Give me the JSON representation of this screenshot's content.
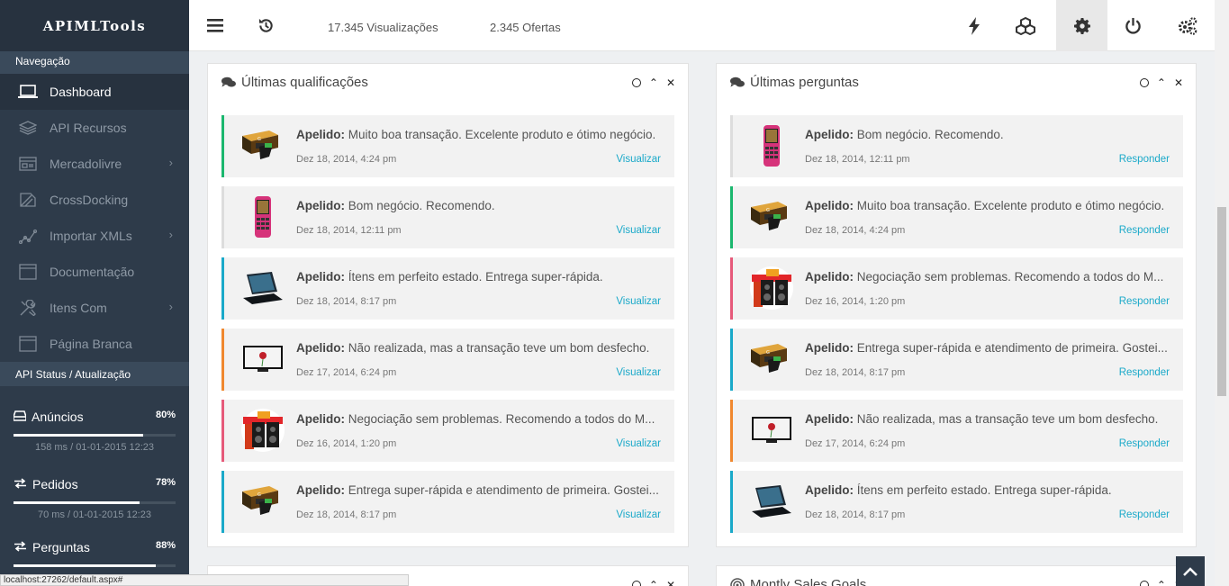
{
  "brand": "APIMLTools",
  "nav_section": "Navegação",
  "nav": [
    {
      "label": "Dashboard",
      "icon": "laptop-icon",
      "active": true
    },
    {
      "label": "API Recursos",
      "icon": "layers-icon"
    },
    {
      "label": "Mercadolivre",
      "icon": "card-icon",
      "chevron": true
    },
    {
      "label": "CrossDocking",
      "icon": "crossdocking-icon"
    },
    {
      "label": "Importar XMLs",
      "icon": "chart-icon",
      "chevron": true
    },
    {
      "label": "Documentação",
      "icon": "document-icon"
    },
    {
      "label": "Itens Com",
      "icon": "tools-icon",
      "chevron": true
    },
    {
      "label": "Página Branca",
      "icon": "blank-page-icon"
    }
  ],
  "api_section": "API Status / Atualização",
  "api": [
    {
      "label": "Anúncios",
      "pct": "80%",
      "meta": "158 ms / 01-01-2015 12:23",
      "progress": 0.8
    },
    {
      "label": "Pedidos",
      "pct": "78%",
      "meta": "70 ms / 01-01-2015 12:23",
      "progress": 0.78
    },
    {
      "label": "Perguntas",
      "pct": "88%",
      "meta": "",
      "progress": 0.88
    }
  ],
  "topbar": {
    "views": "17.345 Visualizações",
    "offers": "2.345 Ofertas"
  },
  "panels": {
    "left": {
      "title": "Últimas qualificações",
      "items": [
        {
          "prefix": "Apelido:",
          "text": " Muito boa transação. Excelente produto e ótimo negócio.",
          "date": "Dez 18, 2014, 4:24 pm",
          "action": "Visualizar",
          "color": "#1bb76e",
          "thumb": "graphics-card"
        },
        {
          "prefix": "Apelido:",
          "text": " Bom negócio. Recomendo.",
          "date": "Dez 18, 2014, 12:11 pm",
          "action": "Visualizar",
          "color": "#dddddd",
          "thumb": "phone"
        },
        {
          "prefix": "Apelido:",
          "text": " Ítens em perfeito estado. Entrega super-rápida.",
          "date": "Dez 18, 2014, 8:17 pm",
          "action": "Visualizar",
          "color": "#1aa9c9",
          "thumb": "laptop"
        },
        {
          "prefix": "Apelido:",
          "text": " Não realizada, mas a transação teve um bom desfecho.",
          "date": "Dez 17, 2014, 6:24 pm",
          "action": "Visualizar",
          "color": "#f0882f",
          "thumb": "monitor"
        },
        {
          "prefix": "Apelido:",
          "text": " Negociação sem problemas. Recomendo a todos do M...",
          "date": "Dez 16, 2014, 1:20 pm",
          "action": "Visualizar",
          "color": "#e65a7a",
          "thumb": "speakers"
        },
        {
          "prefix": "Apelido:",
          "text": " Entrega super-rápida e atendimento de primeira. Gostei...",
          "date": "Dez 18, 2014, 8:17 pm",
          "action": "Visualizar",
          "color": "#1aa9c9",
          "thumb": "graphics-card"
        }
      ]
    },
    "right": {
      "title": "Últimas perguntas",
      "items": [
        {
          "prefix": "Apelido:",
          "text": " Bom negócio. Recomendo.",
          "date": "Dez 18, 2014, 12:11 pm",
          "action": "Responder",
          "color": "#dddddd",
          "thumb": "phone"
        },
        {
          "prefix": "Apelido:",
          "text": " Muito boa transação. Excelente produto e ótimo negócio.",
          "date": "Dez 18, 2014, 4:24 pm",
          "action": "Responder",
          "color": "#1bb76e",
          "thumb": "graphics-card"
        },
        {
          "prefix": "Apelido:",
          "text": " Negociação sem problemas. Recomendo a todos do M...",
          "date": "Dez 16, 2014, 1:20 pm",
          "action": "Responder",
          "color": "#e65a7a",
          "thumb": "speakers"
        },
        {
          "prefix": "Apelido:",
          "text": " Entrega super-rápida e atendimento de primeira. Gostei...",
          "date": "Dez 18, 2014, 8:17 pm",
          "action": "Responder",
          "color": "#1aa9c9",
          "thumb": "graphics-card"
        },
        {
          "prefix": "Apelido:",
          "text": " Não realizada, mas a transação teve um bom desfecho.",
          "date": "Dez 17, 2014, 6:24 pm",
          "action": "Responder",
          "color": "#f0882f",
          "thumb": "monitor"
        },
        {
          "prefix": "Apelido:",
          "text": " Ítens em perfeito estado. Entrega super-rápida.",
          "date": "Dez 18, 2014, 8:17 pm",
          "action": "Responder",
          "color": "#1aa9c9",
          "thumb": "laptop"
        }
      ]
    },
    "bottom_right_title": "Montly Sales Goals"
  },
  "status_url": "localhost:27262/default.aspx#"
}
